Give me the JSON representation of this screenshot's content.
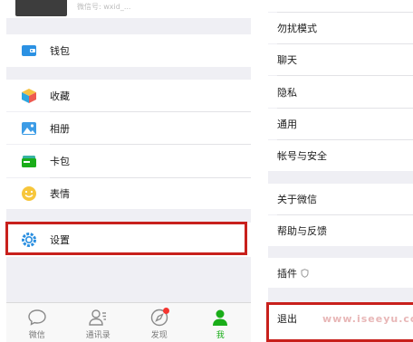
{
  "me_page": {
    "profile": {
      "id_text": "微信号: wxid_..."
    },
    "wallet": "钱包",
    "favorites": "收藏",
    "album": "相册",
    "cards": "卡包",
    "stickers": "表情",
    "settings": "设置"
  },
  "tabbar": {
    "items": [
      {
        "label": "微信",
        "icon": "chat-bubble-icon"
      },
      {
        "label": "通讯录",
        "icon": "contacts-icon"
      },
      {
        "label": "发现",
        "icon": "compass-icon"
      },
      {
        "label": "我",
        "icon": "person-icon"
      }
    ],
    "active_color": "#1aad19"
  },
  "settings_page": {
    "items": [
      "勿扰模式",
      "聊天",
      "隐私",
      "通用",
      "帐号与安全",
      "关于微信",
      "帮助与反馈",
      "插件",
      "退出"
    ]
  },
  "watermark": "www.iseeyu.com",
  "colors": {
    "highlight_box": "#c8201c",
    "badge_dot": "#f43530"
  }
}
